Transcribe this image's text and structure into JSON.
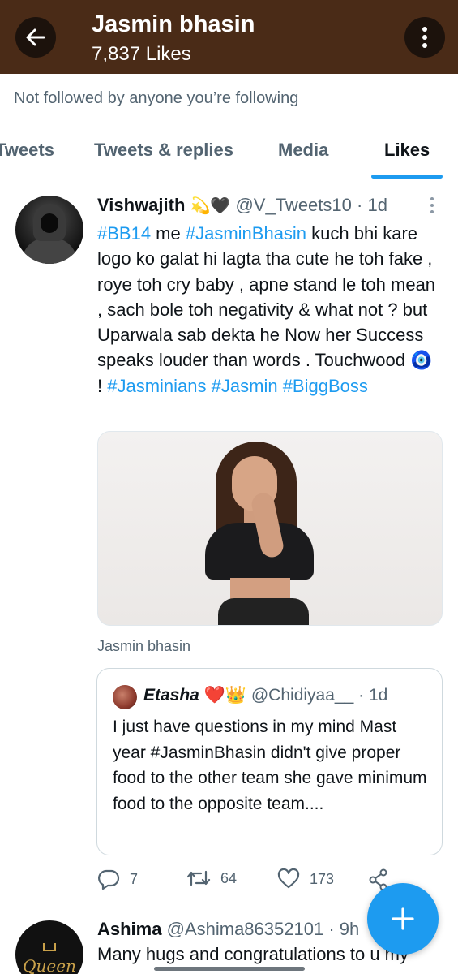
{
  "header": {
    "title": "Jasmin bhasin",
    "likes_count": "7,837 Likes",
    "back_icon": "arrow-left-icon",
    "more_icon": "more-vertical-icon",
    "background_color": "#4a2b17"
  },
  "follow_note": "Not followed by anyone you’re following",
  "tabs": [
    {
      "label": "Tweets",
      "active": false
    },
    {
      "label": "Tweets & replies",
      "active": false
    },
    {
      "label": "Media",
      "active": false
    },
    {
      "label": "Likes",
      "active": true
    }
  ],
  "tweet": {
    "name": "Vishwajith",
    "name_emoji": "💫🖤",
    "handle": "@V_Tweets10",
    "dot": "·",
    "time": "1d",
    "body": [
      {
        "text": "#BB14",
        "hashtag": true
      },
      {
        "text": " me ",
        "hashtag": false
      },
      {
        "text": "#JasminBhasin",
        "hashtag": true
      },
      {
        "text": " kuch bhi kare logo ko galat hi lagta tha cute he toh fake , roye toh cry baby , apne stand le toh mean , sach bole toh negativity & what not ? but Uparwala sab dekta he Now her Success speaks louder than words . Touchwood 🧿 ! ",
        "hashtag": false
      },
      {
        "text": "#Jasminians",
        "hashtag": true
      },
      {
        "text": " ",
        "hashtag": false
      },
      {
        "text": "#Jasmin",
        "hashtag": true
      },
      {
        "text": " ",
        "hashtag": false
      },
      {
        "text": "#BiggBoss",
        "hashtag": true
      }
    ],
    "media_caption": "Jasmin bhasin",
    "quote": {
      "name": "Etasha",
      "name_emoji": "❤️👑",
      "handle": "@Chidiyaa__",
      "dot": "·",
      "time": "1d",
      "body": "I just  have questions in my mind Mast year #JasminBhasin  didn't give proper food to the other team she gave minimum food to the opposite team...."
    },
    "actions": {
      "replies": "7",
      "retweets": "64",
      "likes": "173"
    }
  },
  "tweet2": {
    "name": "Ashima",
    "handle": "@Ashima86352101",
    "dot": "·",
    "time": "9h",
    "body": "Many hugs and congratulations to u my",
    "avatar_text": "Queen"
  },
  "fab_icon": "plus-icon",
  "accent_color": "#1d9bf0"
}
